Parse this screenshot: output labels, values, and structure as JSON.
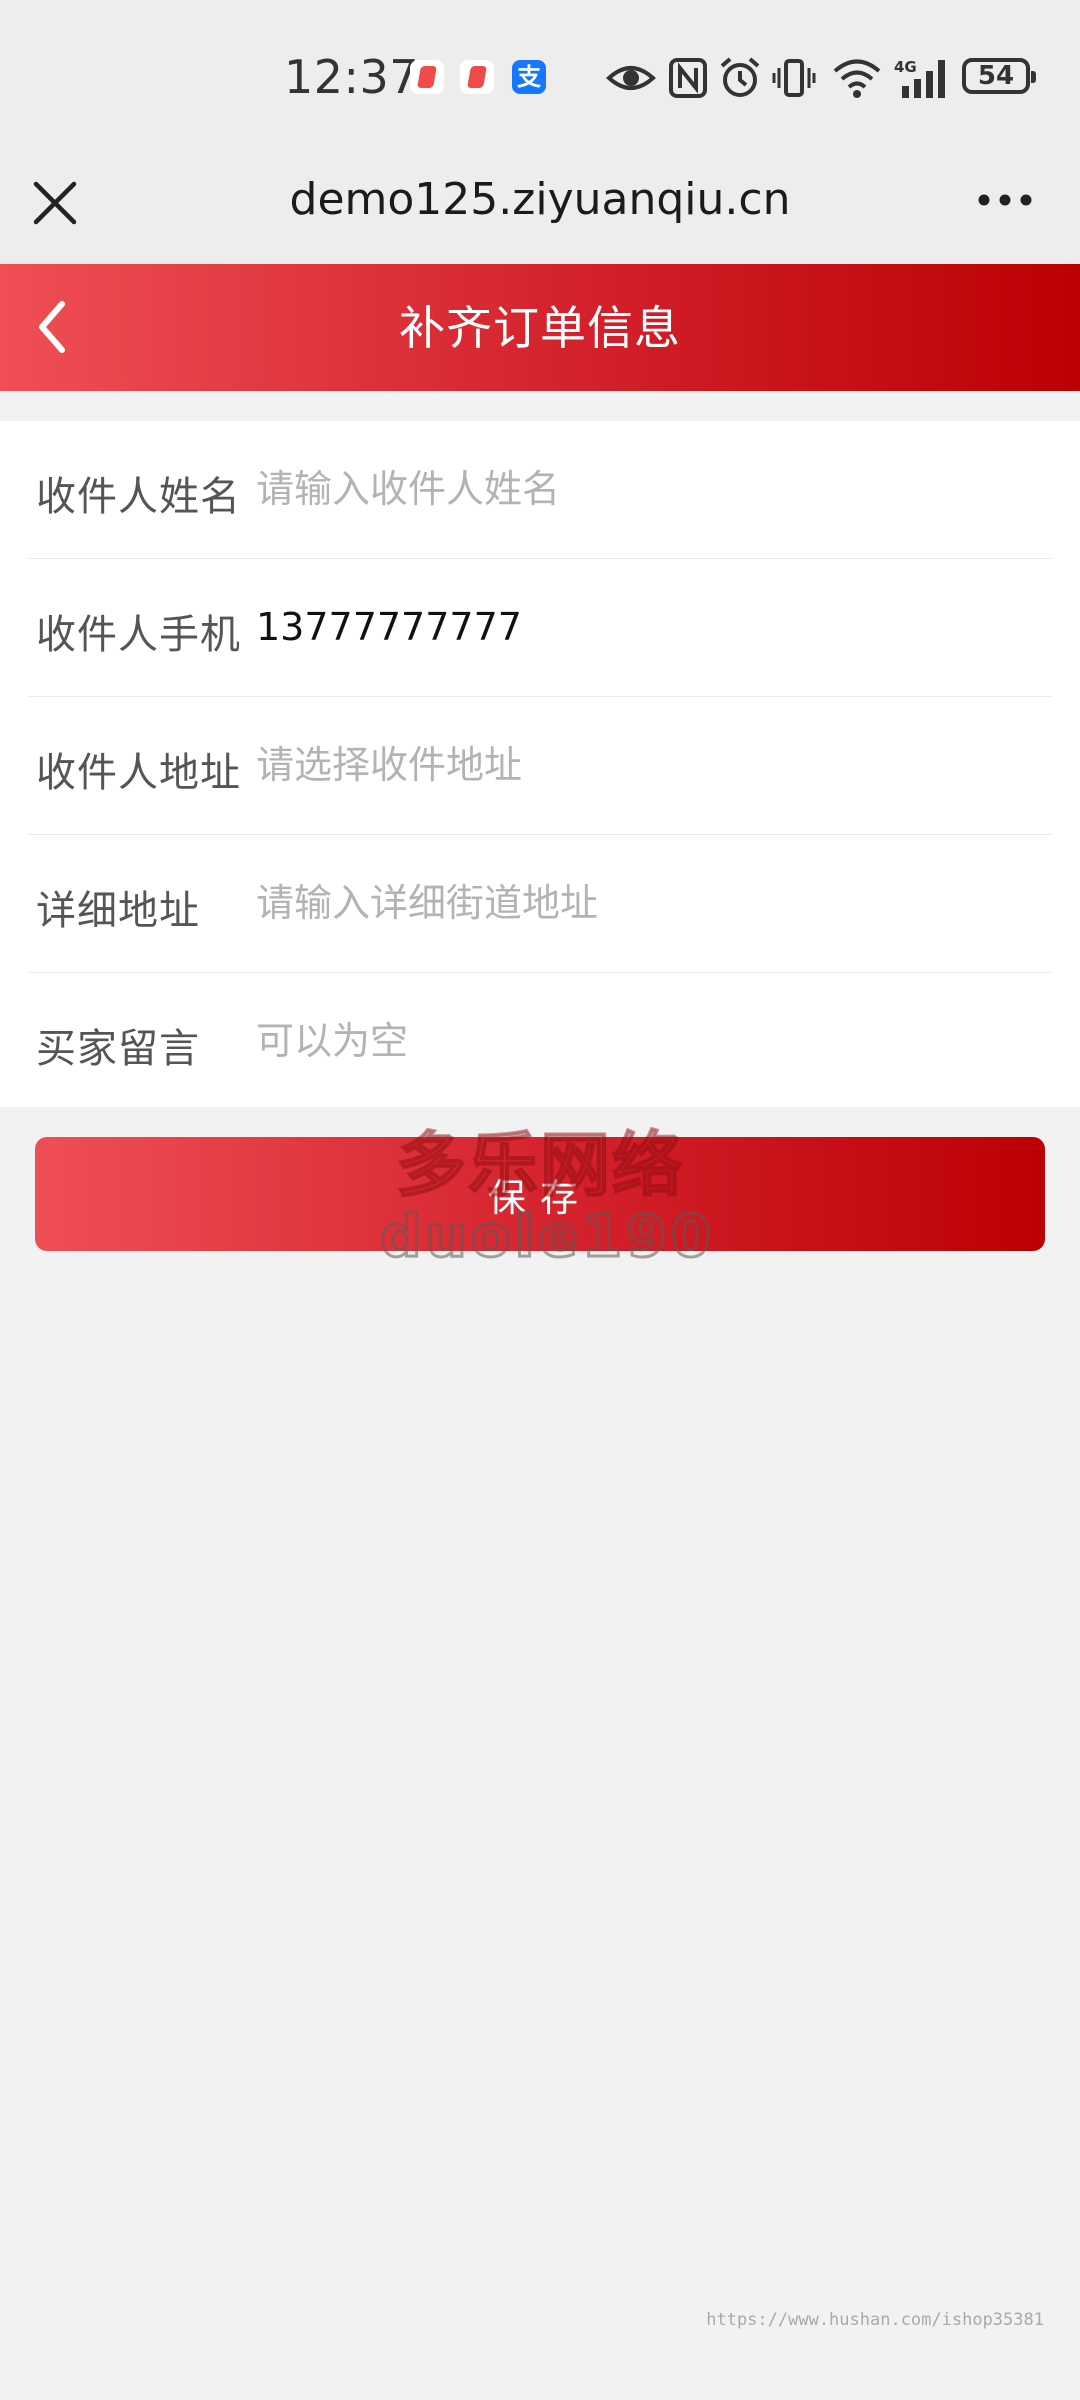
{
  "status_bar": {
    "time": "12:37",
    "notification_icons": [
      "app-red-icon",
      "app-red-icon",
      "alipay-icon"
    ],
    "alipay_glyph": "支",
    "system_icons": [
      "eye-icon",
      "nfc-icon",
      "alarm-icon",
      "vibrate-icon",
      "wifi-icon",
      "signal-4g-icon"
    ],
    "network_label": "4G",
    "battery": "54"
  },
  "browser": {
    "url": "demo125.ziyuanqiu.cn"
  },
  "header": {
    "title": "补齐订单信息"
  },
  "form": {
    "fields": [
      {
        "label": "收件人姓名",
        "value": "",
        "placeholder": "请输入收件人姓名"
      },
      {
        "label": "收件人手机",
        "value": "13777777777",
        "placeholder": ""
      },
      {
        "label": "收件人地址",
        "value": "",
        "placeholder": "请选择收件地址"
      },
      {
        "label": "详细地址",
        "value": "",
        "placeholder": "请输入详细街道地址"
      },
      {
        "label": "买家留言",
        "value": "",
        "placeholder": "可以为空"
      }
    ],
    "save_label": "保存"
  },
  "watermark": {
    "line1": "多乐网络",
    "line2": "duole190"
  },
  "footer": {
    "url": "https://www.hushan.com/ishop35381"
  },
  "colors": {
    "accent_start": "#ef4f55",
    "accent_end": "#bb0004",
    "background": "#f2f2f3"
  }
}
